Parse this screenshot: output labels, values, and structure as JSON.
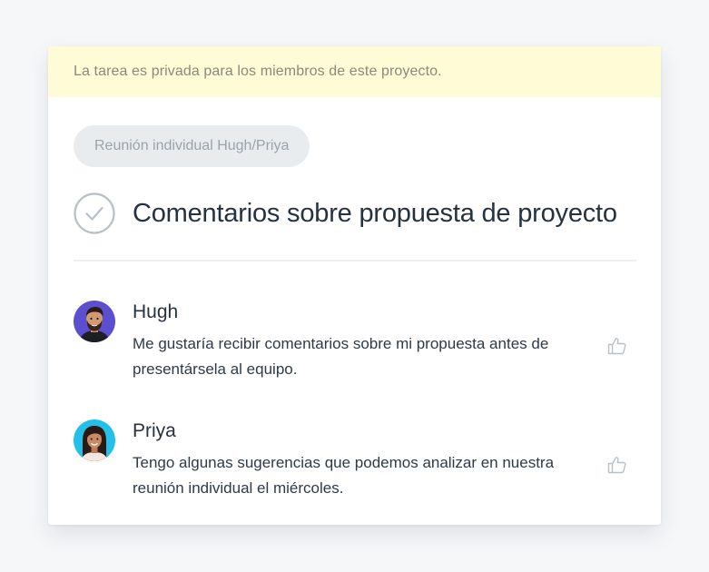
{
  "banner": {
    "text": "La tarea es privada para los miembros de este proyecto."
  },
  "project": {
    "tag": "Reunión individual Hugh/Priya"
  },
  "task": {
    "title": "Comentarios sobre propuesta de proyecto",
    "completed": false
  },
  "comments": [
    {
      "author": "Hugh",
      "text": "Me gustaría recibir comentarios sobre mi propuesta antes de presentársela al equipo.",
      "avatar_color": "#5b4fcf",
      "like_icon": "thumbs-up-icon"
    },
    {
      "author": "Priya",
      "text": "Tengo algunas sugerencias que podemos analizar en nuestra reunión individual el miércoles.",
      "avatar_color": "#25c0ea",
      "like_icon": "thumbs-up-icon"
    }
  ],
  "colors": {
    "banner_bg": "#fffbd6",
    "pill_bg": "#e9ecef",
    "title_text": "#273240",
    "icon_gray": "#b8c0c8"
  }
}
